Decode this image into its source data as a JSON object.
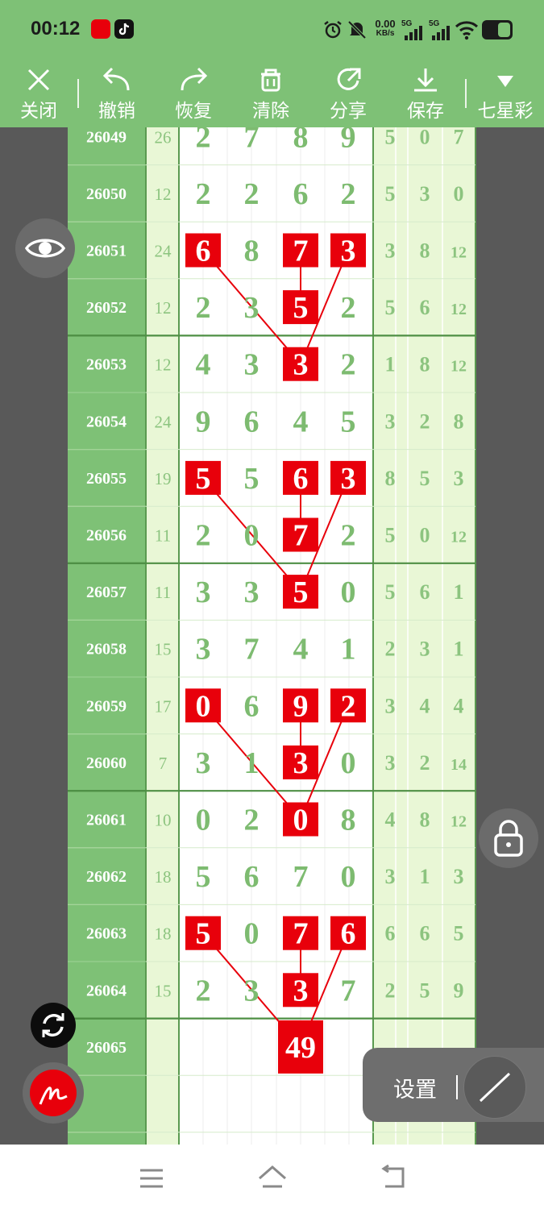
{
  "status_bar": {
    "time": "00:12",
    "speed": "0.00",
    "speed_unit": "KB/s",
    "net1": "5G",
    "net2": "5G"
  },
  "toolbar": {
    "close_label": "关闭",
    "undo_label": "撤销",
    "redo_label": "恢复",
    "clear_label": "清除",
    "share_label": "分享",
    "save_label": "保存",
    "lottery_label": "七星彩"
  },
  "settings_label": "设置",
  "colors": {
    "accent_green": "#7ec176",
    "light_green": "#e9f7d6",
    "highlight_red": "#e8000b",
    "dark_bg": "#595959"
  },
  "grid": {
    "rows": [
      {
        "period": "26049",
        "sum": "26",
        "digits": [
          "2",
          "7",
          "8",
          "9"
        ],
        "right": [
          "5",
          "0",
          "7"
        ],
        "highlight": []
      },
      {
        "period": "26050",
        "sum": "12",
        "digits": [
          "2",
          "2",
          "6",
          "2"
        ],
        "right": [
          "5",
          "3",
          "0"
        ],
        "highlight": []
      },
      {
        "period": "26051",
        "sum": "24",
        "digits": [
          "6",
          "8",
          "7",
          "3"
        ],
        "right": [
          "3",
          "8",
          "12"
        ],
        "highlight": [
          0,
          2,
          3
        ]
      },
      {
        "period": "26052",
        "sum": "12",
        "digits": [
          "2",
          "3",
          "5",
          "2"
        ],
        "right": [
          "5",
          "6",
          "12"
        ],
        "highlight": [
          2
        ]
      },
      {
        "period": "26053",
        "sum": "12",
        "digits": [
          "4",
          "3",
          "3",
          "2"
        ],
        "right": [
          "1",
          "8",
          "12"
        ],
        "highlight": [
          2
        ]
      },
      {
        "period": "26054",
        "sum": "24",
        "digits": [
          "9",
          "6",
          "4",
          "5"
        ],
        "right": [
          "3",
          "2",
          "8"
        ],
        "highlight": []
      },
      {
        "period": "26055",
        "sum": "19",
        "digits": [
          "5",
          "5",
          "6",
          "3"
        ],
        "right": [
          "8",
          "5",
          "3"
        ],
        "highlight": [
          0,
          2,
          3
        ]
      },
      {
        "period": "26056",
        "sum": "11",
        "digits": [
          "2",
          "0",
          "7",
          "2"
        ],
        "right": [
          "5",
          "0",
          "12"
        ],
        "highlight": [
          2
        ]
      },
      {
        "period": "26057",
        "sum": "11",
        "digits": [
          "3",
          "3",
          "5",
          "0"
        ],
        "right": [
          "5",
          "6",
          "1"
        ],
        "highlight": [
          2
        ]
      },
      {
        "period": "26058",
        "sum": "15",
        "digits": [
          "3",
          "7",
          "4",
          "1"
        ],
        "right": [
          "2",
          "3",
          "1"
        ],
        "highlight": []
      },
      {
        "period": "26059",
        "sum": "17",
        "digits": [
          "0",
          "6",
          "9",
          "2"
        ],
        "right": [
          "3",
          "4",
          "4"
        ],
        "highlight": [
          0,
          2,
          3
        ]
      },
      {
        "period": "26060",
        "sum": "7",
        "digits": [
          "3",
          "1",
          "3",
          "0"
        ],
        "right": [
          "3",
          "2",
          "14"
        ],
        "highlight": [
          2
        ]
      },
      {
        "period": "26061",
        "sum": "10",
        "digits": [
          "0",
          "2",
          "0",
          "8"
        ],
        "right": [
          "4",
          "8",
          "12"
        ],
        "highlight": [
          2
        ]
      },
      {
        "period": "26062",
        "sum": "18",
        "digits": [
          "5",
          "6",
          "7",
          "0"
        ],
        "right": [
          "3",
          "1",
          "3"
        ],
        "highlight": []
      },
      {
        "period": "26063",
        "sum": "18",
        "digits": [
          "5",
          "0",
          "7",
          "6"
        ],
        "right": [
          "6",
          "6",
          "5"
        ],
        "highlight": [
          0,
          2,
          3
        ]
      },
      {
        "period": "26064",
        "sum": "15",
        "digits": [
          "2",
          "3",
          "3",
          "7"
        ],
        "right": [
          "2",
          "5",
          "9"
        ],
        "highlight": [
          2
        ]
      },
      {
        "period": "26065",
        "sum": "",
        "digits": [
          "",
          "",
          "49",
          ""
        ],
        "right": [
          "",
          "",
          ""
        ],
        "highlight": [
          2
        ]
      },
      {
        "period": "",
        "sum": "",
        "digits": [
          "",
          "",
          "",
          ""
        ],
        "right": [
          "",
          "",
          ""
        ],
        "highlight": []
      }
    ]
  }
}
